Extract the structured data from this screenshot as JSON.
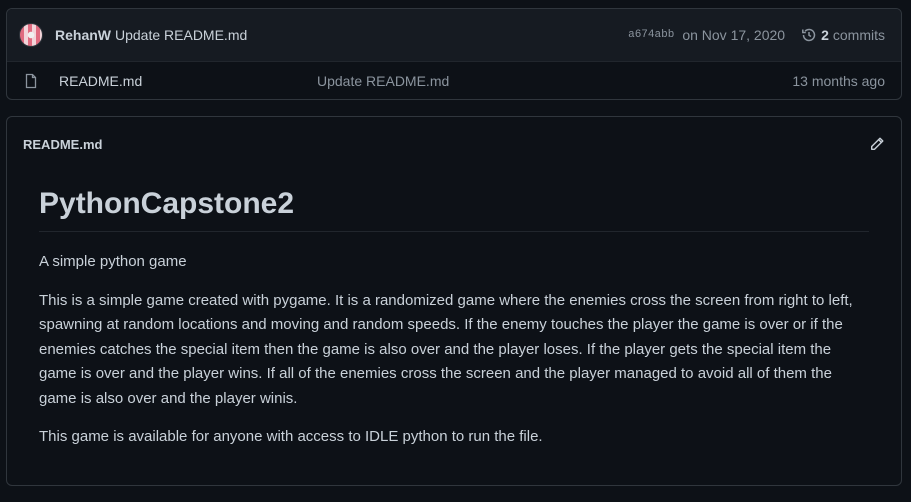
{
  "latest_commit": {
    "author": "RehanW",
    "message": "Update README.md",
    "sha": "a674abb",
    "date": "on Nov 17, 2020",
    "commit_count": "2",
    "commits_label": "commits"
  },
  "files": [
    {
      "name": "README.md",
      "last_commit": "Update README.md",
      "age": "13 months ago",
      "icon": "file-icon"
    }
  ],
  "readme": {
    "filename": "README.md",
    "heading": "PythonCapstone2",
    "paragraphs": [
      "A simple python game",
      "This is a simple game created with pygame. It is a randomized game where the enemies cross the screen from right to left, spawning at random locations and moving and random speeds. If the enemy touches the player the game is over or if the enemies catches the special item then the game is also over and the player loses. If the player gets the special item the game is over and the player wins. If all of the enemies cross the screen and the player managed to avoid all of them the game is also over and the player winis.",
      "This game is available for anyone with access to IDLE python to run the file."
    ]
  },
  "theme": {
    "background": "#0d1117",
    "header_bg": "#161b22",
    "border": "#30363d",
    "text": "#c9d1d9",
    "muted": "#8b949e"
  }
}
